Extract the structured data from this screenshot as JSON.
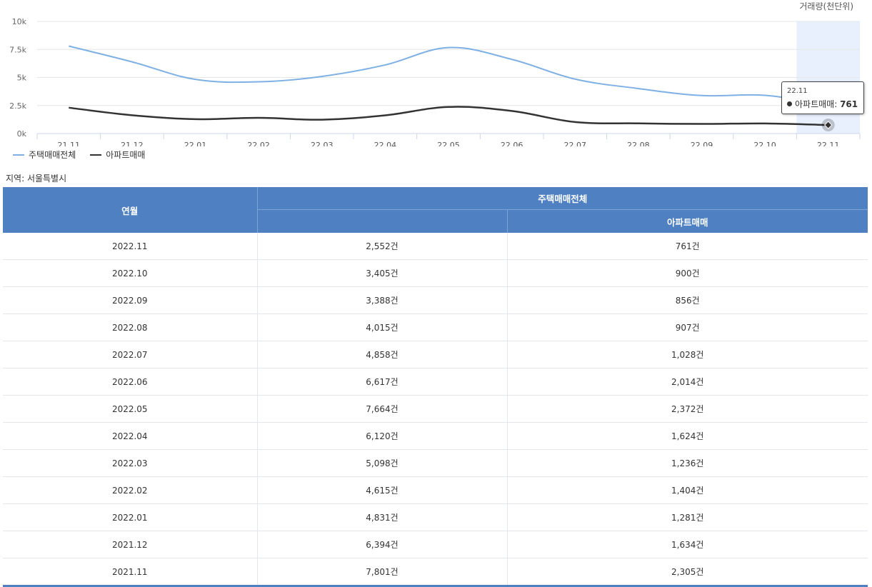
{
  "unit_label": "거래량(천단위)",
  "region_label": "지역: 서울특별시",
  "legend": [
    {
      "name": "주택매매전체",
      "color": "#7eb0e4"
    },
    {
      "name": "아파트매매",
      "color": "#333333"
    }
  ],
  "tooltip": {
    "date": "22.11",
    "series": "아파트매매",
    "value": "761"
  },
  "chart_data": {
    "type": "line",
    "x": [
      "21.11",
      "21.12",
      "22.01",
      "22.02",
      "22.03",
      "22.04",
      "22.05",
      "22.06",
      "22.07",
      "22.08",
      "22.09",
      "22.10",
      "22.11"
    ],
    "y_ticks": [
      "0k",
      "2.5k",
      "5k",
      "7.5k",
      "10k"
    ],
    "ylim": [
      0,
      10000
    ],
    "series": [
      {
        "name": "주택매매전체",
        "color": "#7eb0e4",
        "values": [
          7801,
          6394,
          4831,
          4615,
          5098,
          6120,
          7664,
          6617,
          4858,
          4015,
          3388,
          3405,
          2552
        ]
      },
      {
        "name": "아파트매매",
        "color": "#333333",
        "values": [
          2305,
          1634,
          1281,
          1404,
          1236,
          1624,
          2372,
          2014,
          1028,
          907,
          856,
          900,
          761
        ]
      }
    ],
    "highlight_index": 12,
    "grid": true,
    "legend_position": "bottom-left"
  },
  "table": {
    "header_month": "연월",
    "header_total": "주택매매전체",
    "header_apt": "아파트매매",
    "rows": [
      {
        "month": "2022.11",
        "total": "2,552건",
        "apt": "761건"
      },
      {
        "month": "2022.10",
        "total": "3,405건",
        "apt": "900건"
      },
      {
        "month": "2022.09",
        "total": "3,388건",
        "apt": "856건"
      },
      {
        "month": "2022.08",
        "total": "4,015건",
        "apt": "907건"
      },
      {
        "month": "2022.07",
        "total": "4,858건",
        "apt": "1,028건"
      },
      {
        "month": "2022.06",
        "total": "6,617건",
        "apt": "2,014건"
      },
      {
        "month": "2022.05",
        "total": "7,664건",
        "apt": "2,372건"
      },
      {
        "month": "2022.04",
        "total": "6,120건",
        "apt": "1,624건"
      },
      {
        "month": "2022.03",
        "total": "5,098건",
        "apt": "1,236건"
      },
      {
        "month": "2022.02",
        "total": "4,615건",
        "apt": "1,404건"
      },
      {
        "month": "2022.01",
        "total": "4,831건",
        "apt": "1,281건"
      },
      {
        "month": "2021.12",
        "total": "6,394건",
        "apt": "1,634건"
      },
      {
        "month": "2021.11",
        "total": "7,801건",
        "apt": "2,305건"
      }
    ]
  }
}
